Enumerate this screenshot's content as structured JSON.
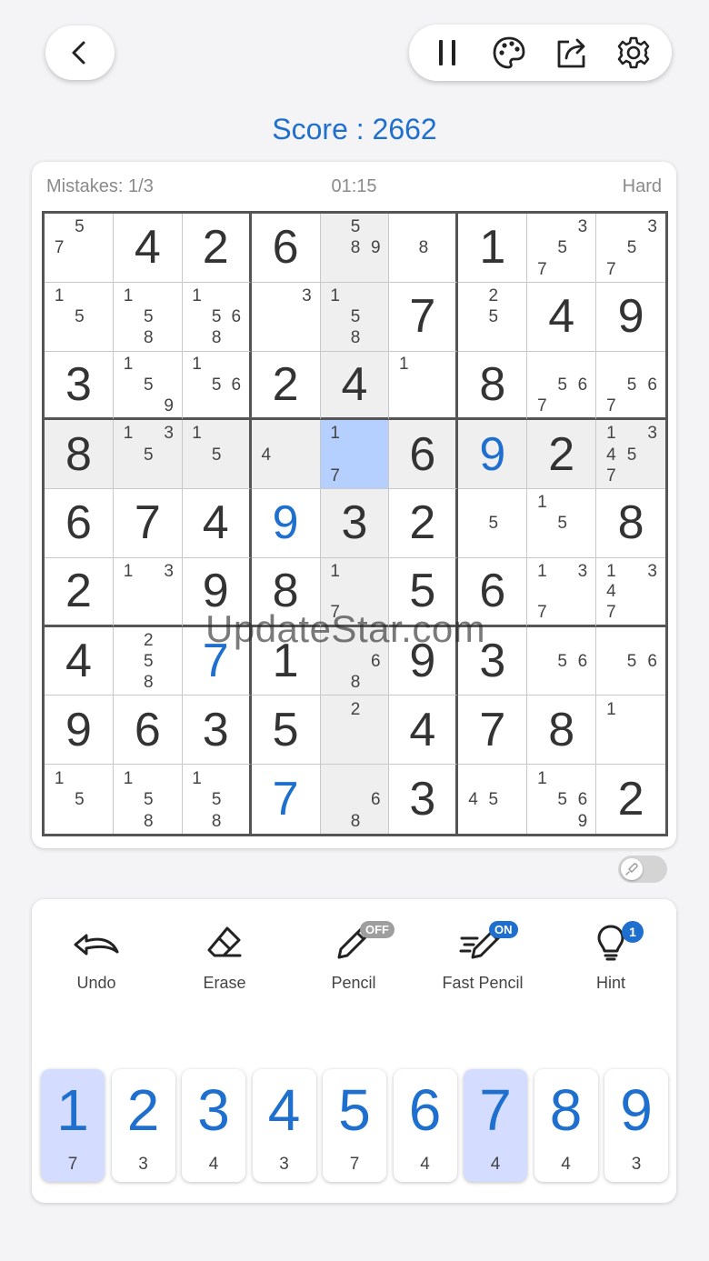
{
  "header": {
    "score_label": "Score : ",
    "score_value": "2662"
  },
  "status": {
    "mistakes": "Mistakes: 1/3",
    "timer": "01:15",
    "difficulty": "Hard"
  },
  "board": [
    [
      {
        "v": "",
        "n": [
          "",
          "5",
          "",
          "7",
          "",
          "",
          "",
          "",
          ""
        ]
      },
      {
        "v": "4",
        "n": null
      },
      {
        "v": "2",
        "n": null
      },
      {
        "v": "6",
        "n": null
      },
      {
        "v": "",
        "n": [
          "",
          "5",
          "",
          "",
          "8",
          "9",
          "",
          "",
          ""
        ]
      },
      {
        "v": "",
        "n": [
          "",
          "",
          "",
          "",
          "8",
          "",
          "",
          "",
          ""
        ]
      },
      {
        "v": "1",
        "n": null
      },
      {
        "v": "",
        "n": [
          "",
          "",
          "3",
          "",
          "5",
          "",
          "7",
          "",
          ""
        ]
      },
      {
        "v": "",
        "n": [
          "",
          "",
          "3",
          "",
          "5",
          "",
          "7",
          "",
          ""
        ]
      }
    ],
    [
      {
        "v": "",
        "n": [
          "1",
          "",
          "",
          "",
          "5",
          "",
          "",
          "",
          ""
        ]
      },
      {
        "v": "",
        "n": [
          "1",
          "",
          "",
          "",
          "5",
          "",
          "",
          "8",
          ""
        ]
      },
      {
        "v": "",
        "n": [
          "1",
          "",
          "",
          "",
          "5",
          "6",
          "",
          "8",
          ""
        ]
      },
      {
        "v": "",
        "n": [
          "",
          "",
          "3",
          "",
          "",
          "",
          "",
          "",
          ""
        ]
      },
      {
        "v": "",
        "n": [
          "1",
          "",
          "",
          "",
          "5",
          "",
          "",
          "8",
          ""
        ]
      },
      {
        "v": "7",
        "n": null
      },
      {
        "v": "",
        "n": [
          "",
          "2",
          "",
          "",
          "5",
          "",
          "",
          "",
          ""
        ]
      },
      {
        "v": "4",
        "n": null
      },
      {
        "v": "9",
        "n": null
      }
    ],
    [
      {
        "v": "3",
        "n": null
      },
      {
        "v": "",
        "n": [
          "1",
          "",
          "",
          "",
          "5",
          "",
          "",
          "",
          "9"
        ]
      },
      {
        "v": "",
        "n": [
          "1",
          "",
          "",
          "",
          "5",
          "6",
          "",
          "",
          ""
        ]
      },
      {
        "v": "2",
        "n": null
      },
      {
        "v": "4",
        "n": null
      },
      {
        "v": "",
        "n": [
          "1",
          "",
          "",
          "",
          "",
          "",
          "",
          "",
          ""
        ]
      },
      {
        "v": "8",
        "n": null
      },
      {
        "v": "",
        "n": [
          "",
          "",
          "",
          "",
          "5",
          "6",
          "7",
          "",
          ""
        ]
      },
      {
        "v": "",
        "n": [
          "",
          "",
          "",
          "",
          "5",
          "6",
          "7",
          "",
          ""
        ]
      }
    ],
    [
      {
        "v": "8",
        "n": null
      },
      {
        "v": "",
        "n": [
          "1",
          "",
          "3",
          "",
          "5",
          "",
          "",
          "",
          ""
        ]
      },
      {
        "v": "",
        "n": [
          "1",
          "",
          "",
          "",
          "5",
          "",
          "",
          "",
          ""
        ]
      },
      {
        "v": "",
        "n": [
          "",
          "",
          "",
          "4",
          "",
          "",
          "",
          "",
          ""
        ]
      },
      {
        "v": "",
        "n": [
          "1",
          "",
          "",
          "",
          "",
          "",
          "7",
          "",
          ""
        ]
      },
      {
        "v": "6",
        "n": null
      },
      {
        "v": "9",
        "u": true,
        "n": null
      },
      {
        "v": "2",
        "n": null
      },
      {
        "v": "",
        "n": [
          "1",
          "",
          "3",
          "4",
          "5",
          "",
          "7",
          "",
          ""
        ]
      }
    ],
    [
      {
        "v": "6",
        "n": null
      },
      {
        "v": "7",
        "n": null
      },
      {
        "v": "4",
        "n": null
      },
      {
        "v": "9",
        "u": true,
        "n": null
      },
      {
        "v": "3",
        "n": null
      },
      {
        "v": "2",
        "n": null
      },
      {
        "v": "",
        "n": [
          "",
          "",
          "",
          "",
          "5",
          "",
          "",
          "",
          ""
        ]
      },
      {
        "v": "",
        "n": [
          "1",
          "",
          "",
          "",
          "5",
          "",
          "",
          "",
          ""
        ]
      },
      {
        "v": "8",
        "n": null
      }
    ],
    [
      {
        "v": "2",
        "n": null
      },
      {
        "v": "",
        "n": [
          "1",
          "",
          "3",
          "",
          "",
          "",
          "",
          "",
          ""
        ]
      },
      {
        "v": "9",
        "n": null
      },
      {
        "v": "8",
        "n": null
      },
      {
        "v": "",
        "n": [
          "1",
          "",
          "",
          "",
          "",
          "",
          "7",
          "",
          ""
        ]
      },
      {
        "v": "5",
        "n": null
      },
      {
        "v": "6",
        "n": null
      },
      {
        "v": "",
        "n": [
          "1",
          "",
          "3",
          "",
          "",
          "",
          "7",
          "",
          ""
        ]
      },
      {
        "v": "",
        "n": [
          "1",
          "",
          "3",
          "4",
          "",
          "",
          "7",
          "",
          ""
        ]
      }
    ],
    [
      {
        "v": "4",
        "n": null
      },
      {
        "v": "",
        "n": [
          "",
          "2",
          "",
          "",
          "5",
          "",
          "",
          "8",
          ""
        ]
      },
      {
        "v": "7",
        "u": true,
        "n": null
      },
      {
        "v": "1",
        "n": null
      },
      {
        "v": "",
        "n": [
          "",
          "",
          "",
          "",
          "",
          "6",
          "",
          "8",
          ""
        ]
      },
      {
        "v": "9",
        "n": null
      },
      {
        "v": "3",
        "n": null
      },
      {
        "v": "",
        "n": [
          "",
          "",
          "",
          "",
          "5",
          "6",
          "",
          "",
          ""
        ]
      },
      {
        "v": "",
        "n": [
          "",
          "",
          "",
          "",
          "5",
          "6",
          "",
          "",
          ""
        ]
      }
    ],
    [
      {
        "v": "9",
        "n": null
      },
      {
        "v": "6",
        "n": null
      },
      {
        "v": "3",
        "n": null
      },
      {
        "v": "5",
        "n": null
      },
      {
        "v": "",
        "n": [
          "",
          "2",
          "",
          "",
          "",
          "",
          "",
          "",
          ""
        ]
      },
      {
        "v": "4",
        "n": null
      },
      {
        "v": "7",
        "n": null
      },
      {
        "v": "8",
        "n": null
      },
      {
        "v": "",
        "n": [
          "1",
          "",
          "",
          "",
          "",
          "",
          "",
          "",
          ""
        ]
      }
    ],
    [
      {
        "v": "",
        "n": [
          "1",
          "",
          "",
          "",
          "5",
          "",
          "",
          "",
          ""
        ]
      },
      {
        "v": "",
        "n": [
          "1",
          "",
          "",
          "",
          "5",
          "",
          "",
          "8",
          ""
        ]
      },
      {
        "v": "",
        "n": [
          "1",
          "",
          "",
          "",
          "5",
          "",
          "",
          "8",
          ""
        ]
      },
      {
        "v": "7",
        "u": true,
        "n": null
      },
      {
        "v": "",
        "n": [
          "",
          "",
          "",
          "",
          "",
          "6",
          "",
          "8",
          ""
        ]
      },
      {
        "v": "3",
        "n": null
      },
      {
        "v": "",
        "n": [
          "",
          "",
          "",
          "4",
          "5",
          "",
          "",
          "",
          ""
        ]
      },
      {
        "v": "",
        "n": [
          "1",
          "",
          "",
          "",
          "5",
          "6",
          "",
          "",
          "9"
        ]
      },
      {
        "v": "2",
        "n": null
      }
    ]
  ],
  "highlight": {
    "selected_row": 3,
    "selected_col": 4,
    "shade_row": 3,
    "shade_col": 4,
    "shade_box": [
      3,
      3
    ]
  },
  "watermark": "UpdateStar.com",
  "tools": {
    "undo": "Undo",
    "erase": "Erase",
    "pencil": "Pencil",
    "pencil_state": "OFF",
    "fast_pencil": "Fast Pencil",
    "fast_pencil_state": "ON",
    "hint": "Hint",
    "hint_count": "1"
  },
  "numpad": [
    {
      "digit": "1",
      "remaining": "7",
      "active": true
    },
    {
      "digit": "2",
      "remaining": "3",
      "active": false
    },
    {
      "digit": "3",
      "remaining": "4",
      "active": false
    },
    {
      "digit": "4",
      "remaining": "3",
      "active": false
    },
    {
      "digit": "5",
      "remaining": "7",
      "active": false
    },
    {
      "digit": "6",
      "remaining": "4",
      "active": false
    },
    {
      "digit": "7",
      "remaining": "4",
      "active": true
    },
    {
      "digit": "8",
      "remaining": "4",
      "active": false
    },
    {
      "digit": "9",
      "remaining": "3",
      "active": false
    }
  ],
  "colors": {
    "accent": "#1f6fcf",
    "selected_cell": "#b5cfff",
    "shade": "#efefef",
    "active_key": "#d4dcff"
  },
  "icons": [
    "back-icon",
    "pause-icon",
    "palette-icon",
    "share-icon",
    "settings-icon",
    "undo-icon",
    "eraser-icon",
    "pencil-icon",
    "fast-pencil-icon",
    "lightbulb-icon",
    "rocket-icon"
  ]
}
